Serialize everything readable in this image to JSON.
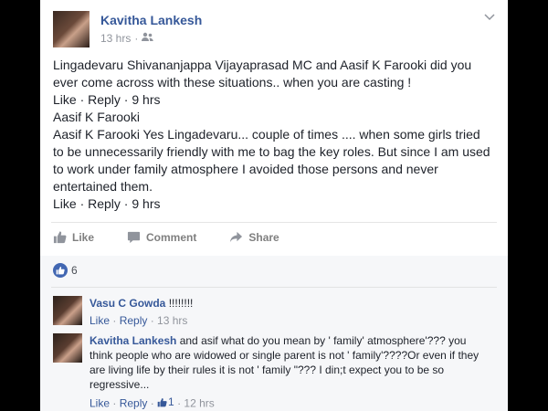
{
  "post": {
    "author": "Kavitha Lankesh",
    "time": "13 hrs",
    "separator": "·",
    "audience_icon": "friends-icon",
    "body_lines": [
      "Lingadevaru Shivananjappa Vijayaprasad MC and Aasif K Farooki did you ever come across with these situations.. when you are casting !",
      "Like · Reply · 9 hrs",
      "Aasif K Farooki",
      "Aasif K Farooki Yes Lingadevaru... couple of times .... when some girls tried to be unnecessarily friendly with me to bag the key roles. But since I am used to work under family atmosphere I avoided those persons and never entertained them.",
      "Like · Reply · 9 hrs"
    ]
  },
  "actions": {
    "like": "Like",
    "comment": "Comment",
    "share": "Share"
  },
  "reactions": {
    "count": "6"
  },
  "comments": [
    {
      "author": "Vasu C Gowda",
      "text": " !!!!!!!!",
      "like": "Like",
      "reply": "Reply",
      "time": "13 hrs"
    },
    {
      "author": "Kavitha Lankesh",
      "text": " and asif what do you mean by ' family' atmosphere'??? you think people who are widowed or single parent is not ' family'????Or even if they are living life by their rules it is not ' family \"??? I din;t expect you to be so regressive...",
      "like": "Like",
      "reply": "Reply",
      "likes": "1",
      "time": "12 hrs"
    }
  ]
}
